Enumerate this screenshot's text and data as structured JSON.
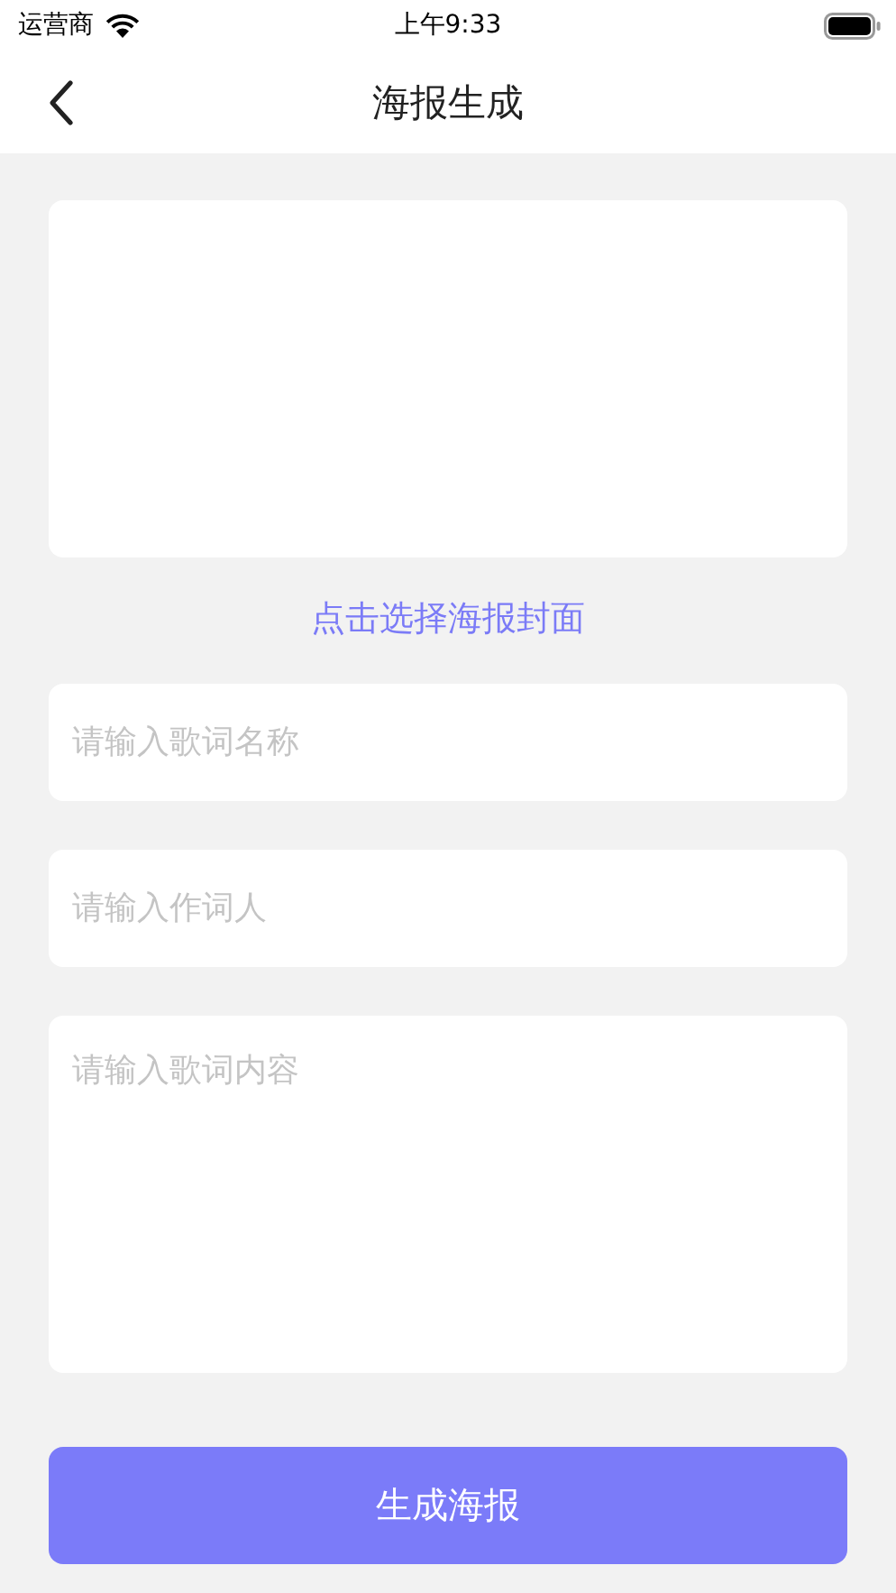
{
  "status_bar": {
    "carrier": "运营商",
    "time": "上午9:33"
  },
  "nav": {
    "title": "海报生成"
  },
  "cover": {
    "kind": "picture-slot",
    "action": "点击选择海报封面"
  },
  "fields": [
    {
      "kind": "input",
      "placeholder": "请输入歌词名称"
    },
    {
      "kind": "input",
      "placeholder": "请输入作词人"
    },
    {
      "kind": "textarea",
      "placeholder": "请输入歌词内容"
    }
  ],
  "submit": {
    "label": "生成海报"
  }
}
